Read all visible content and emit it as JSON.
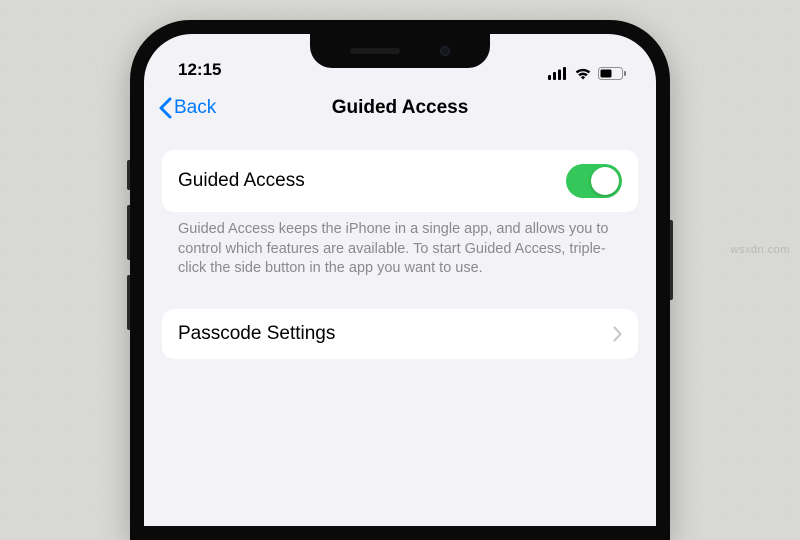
{
  "watermark": "wsxdn.com",
  "statusbar": {
    "time": "12:15"
  },
  "nav": {
    "back_label": "Back",
    "title": "Guided Access"
  },
  "main": {
    "toggle_label": "Guided Access",
    "toggle_on": true,
    "description": "Guided Access keeps the iPhone in a single app, and allows you to control which features are available. To start Guided Access, triple-click the side button in the app you want to use."
  },
  "passcode": {
    "label": "Passcode Settings"
  },
  "colors": {
    "accent": "#007aff",
    "toggle_on": "#34c759",
    "bg": "#f2f2f7"
  }
}
